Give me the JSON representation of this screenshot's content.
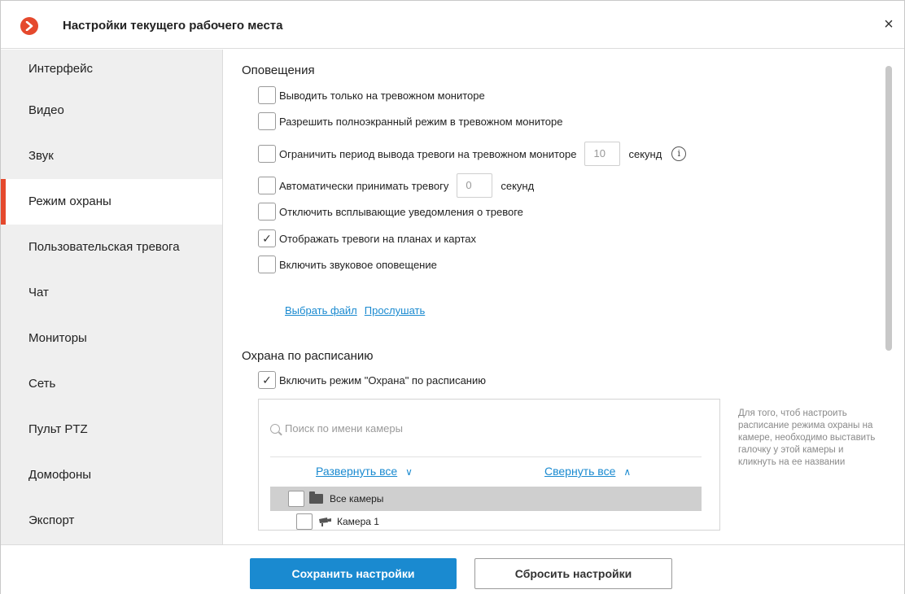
{
  "window": {
    "title": "Настройки текущего рабочего места",
    "close_label": "×"
  },
  "sidebar": {
    "items": [
      {
        "label": "Интерфейс"
      },
      {
        "label": "Видео"
      },
      {
        "label": "Звук"
      },
      {
        "label": "Режим охраны",
        "active": true
      },
      {
        "label": "Пользовательская тревога"
      },
      {
        "label": "Чат"
      },
      {
        "label": "Мониторы"
      },
      {
        "label": "Сеть"
      },
      {
        "label": "Пульт PTZ"
      },
      {
        "label": "Домофоны"
      },
      {
        "label": "Экспорт"
      }
    ]
  },
  "notifications": {
    "title": "Оповещения",
    "options": [
      {
        "label": "Выводить только на тревожном мониторе",
        "checked": false
      },
      {
        "label": "Разрешить полноэкранный режим в тревожном мониторе",
        "checked": false
      },
      {
        "label": "Ограничить период вывода тревоги на тревожном мониторе",
        "checked": false,
        "value": "10",
        "unit": "секунд"
      },
      {
        "label": "Автоматически принимать тревогу",
        "checked": false,
        "value": "0",
        "unit": "секунд"
      },
      {
        "label": "Отключить всплывающие уведомления о тревоге",
        "checked": false
      },
      {
        "label": "Отображать тревоги на планах и картах",
        "checked": true
      },
      {
        "label": "Включить звуковое оповещение",
        "checked": false
      }
    ],
    "select_file": "Выбрать файл",
    "listen": "Прослушать"
  },
  "schedule": {
    "title": "Охрана по расписанию",
    "enable_label": "Включить режим \"Охрана\" по расписанию",
    "enable_checked": true,
    "search_placeholder": "Поиск по имени камеры",
    "expand_all": "Развернуть все",
    "collapse_all": "Свернуть все",
    "tree": {
      "all_cameras": "Все камеры",
      "cameras": [
        "Камера 1"
      ]
    },
    "hint": "Для того, чтоб настроить расписание режима охраны на камере, необходимо выставить галочку у этой камеры и кликнуть на ее названии"
  },
  "footer": {
    "save_label": "Сохранить настройки",
    "reset_label": "Сбросить настройки"
  },
  "colors": {
    "accent": "#1a8ad0",
    "brand": "#e5492d",
    "sidebar_bg": "#efefef"
  }
}
